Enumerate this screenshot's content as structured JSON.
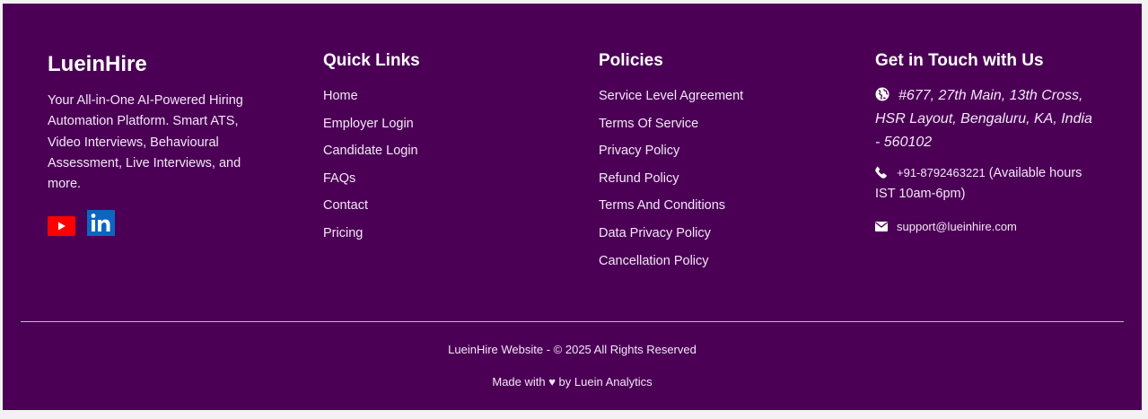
{
  "brand": {
    "name": "LueinHire",
    "description": "Your All-in-One AI-Powered Hiring Automation Platform. Smart ATS, Video Interviews, Behavioural Assessment, Live Interviews, and more."
  },
  "social": [
    {
      "name": "youtube-icon",
      "color": "#ff0000"
    },
    {
      "name": "linkedin-icon",
      "color": "#0a66c2"
    }
  ],
  "quick_links": {
    "heading": "Quick Links",
    "items": [
      "Home",
      "Employer Login",
      "Candidate Login",
      "FAQs",
      "Contact",
      "Pricing"
    ]
  },
  "policies": {
    "heading": "Policies",
    "items": [
      "Service Level Agreement",
      "Terms Of Service",
      "Privacy Policy",
      "Refund Policy",
      "Terms And Conditions",
      "Data Privacy Policy",
      "Cancellation Policy"
    ]
  },
  "contact": {
    "heading": "Get in Touch with Us",
    "address": "#677, 27th Main, 13th Cross, HSR Layout, Bengaluru, KA, India - 560102",
    "phone": "+91-8792463221",
    "phone_note": " (Available hours IST 10am-6pm)",
    "email": "support@lueinhire.com"
  },
  "bottom": {
    "copyright": "LueinHire Website - © 2025 All Rights Reserved",
    "made_with": "Made with ♥ by Luein Analytics"
  },
  "colors": {
    "footer_bg": "#4b0056",
    "text": "#f3e6f5"
  }
}
